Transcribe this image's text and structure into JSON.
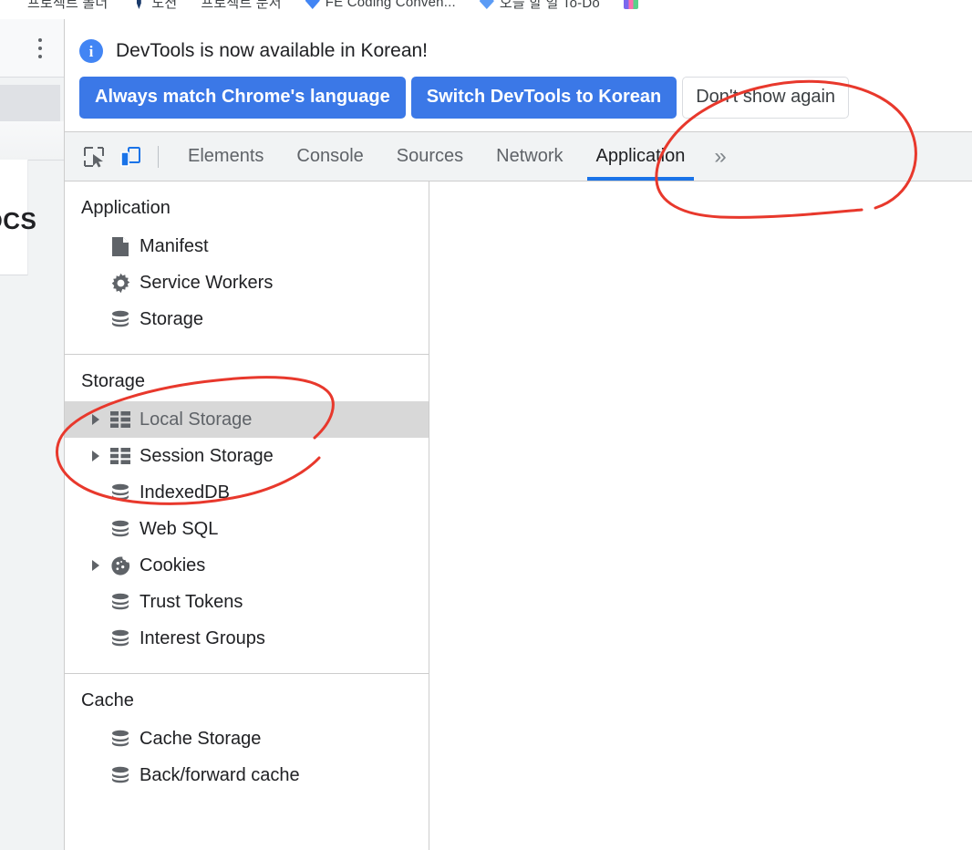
{
  "browser": {
    "bookmarks": [
      {
        "label": "프로젝트 폴더",
        "icon": "none"
      },
      {
        "label": "노션",
        "icon": "dark-pin-icon"
      },
      {
        "label": "프로젝트 문서",
        "icon": "none"
      },
      {
        "label": "FE Coding Conven...",
        "icon": "blue-drop-icon"
      },
      {
        "label": "오늘 할 일 To-Do",
        "icon": "blue-light-icon"
      },
      {
        "label": "",
        "icon": "multicolor-icon"
      }
    ]
  },
  "page_behind": {
    "clipped_text": "DCS",
    "menu_icon": "more-vertical-icon"
  },
  "devtools": {
    "notification": {
      "icon": "info-icon",
      "message": "DevTools is now available in Korean!",
      "buttons": [
        {
          "label": "Always match Chrome's language",
          "style": "primary"
        },
        {
          "label": "Switch DevTools to Korean",
          "style": "primary"
        },
        {
          "label": "Don't show again",
          "style": "secondary"
        }
      ]
    },
    "toolbar": {
      "inspect_icon": "inspect-element-icon",
      "device_icon": "device-toolbar-icon",
      "device_active": true,
      "more_tabs_label": "»"
    },
    "tabs": [
      {
        "label": "Elements",
        "active": false
      },
      {
        "label": "Console",
        "active": false
      },
      {
        "label": "Sources",
        "active": false
      },
      {
        "label": "Network",
        "active": false
      },
      {
        "label": "Application",
        "active": true
      }
    ],
    "sidebar": {
      "groups": [
        {
          "title": "Application",
          "items": [
            {
              "label": "Manifest",
              "icon": "manifest-page-icon",
              "expandable": false,
              "selected": false
            },
            {
              "label": "Service Workers",
              "icon": "gear-icon",
              "expandable": false,
              "selected": false
            },
            {
              "label": "Storage",
              "icon": "database-icon",
              "expandable": false,
              "selected": false
            }
          ]
        },
        {
          "title": "Storage",
          "items": [
            {
              "label": "Local Storage",
              "icon": "table-grid-icon",
              "expandable": true,
              "selected": true
            },
            {
              "label": "Session Storage",
              "icon": "table-grid-icon",
              "expandable": true,
              "selected": false
            },
            {
              "label": "IndexedDB",
              "icon": "database-icon",
              "expandable": false,
              "selected": false
            },
            {
              "label": "Web SQL",
              "icon": "database-icon",
              "expandable": false,
              "selected": false
            },
            {
              "label": "Cookies",
              "icon": "cookie-icon",
              "expandable": true,
              "selected": false
            },
            {
              "label": "Trust Tokens",
              "icon": "database-icon",
              "expandable": false,
              "selected": false
            },
            {
              "label": "Interest Groups",
              "icon": "database-icon",
              "expandable": false,
              "selected": false
            }
          ]
        },
        {
          "title": "Cache",
          "items": [
            {
              "label": "Cache Storage",
              "icon": "database-icon",
              "expandable": false,
              "selected": false
            },
            {
              "label": "Back/forward cache",
              "icon": "database-icon",
              "expandable": false,
              "selected": false
            }
          ]
        }
      ]
    }
  },
  "annotations": {
    "ink_color": "#e8382c",
    "marks": [
      {
        "name": "circle-around-application-tab"
      },
      {
        "name": "circle-around-local-and-session-storage"
      }
    ]
  },
  "colors": {
    "accent_blue": "#1a73e8",
    "button_blue": "#3b78e7",
    "tabstrip_bg": "#f1f3f4",
    "selected_row": "#d8d8d8",
    "text_primary": "#202124",
    "text_secondary": "#5f6368",
    "ink_red": "#e8382c"
  }
}
